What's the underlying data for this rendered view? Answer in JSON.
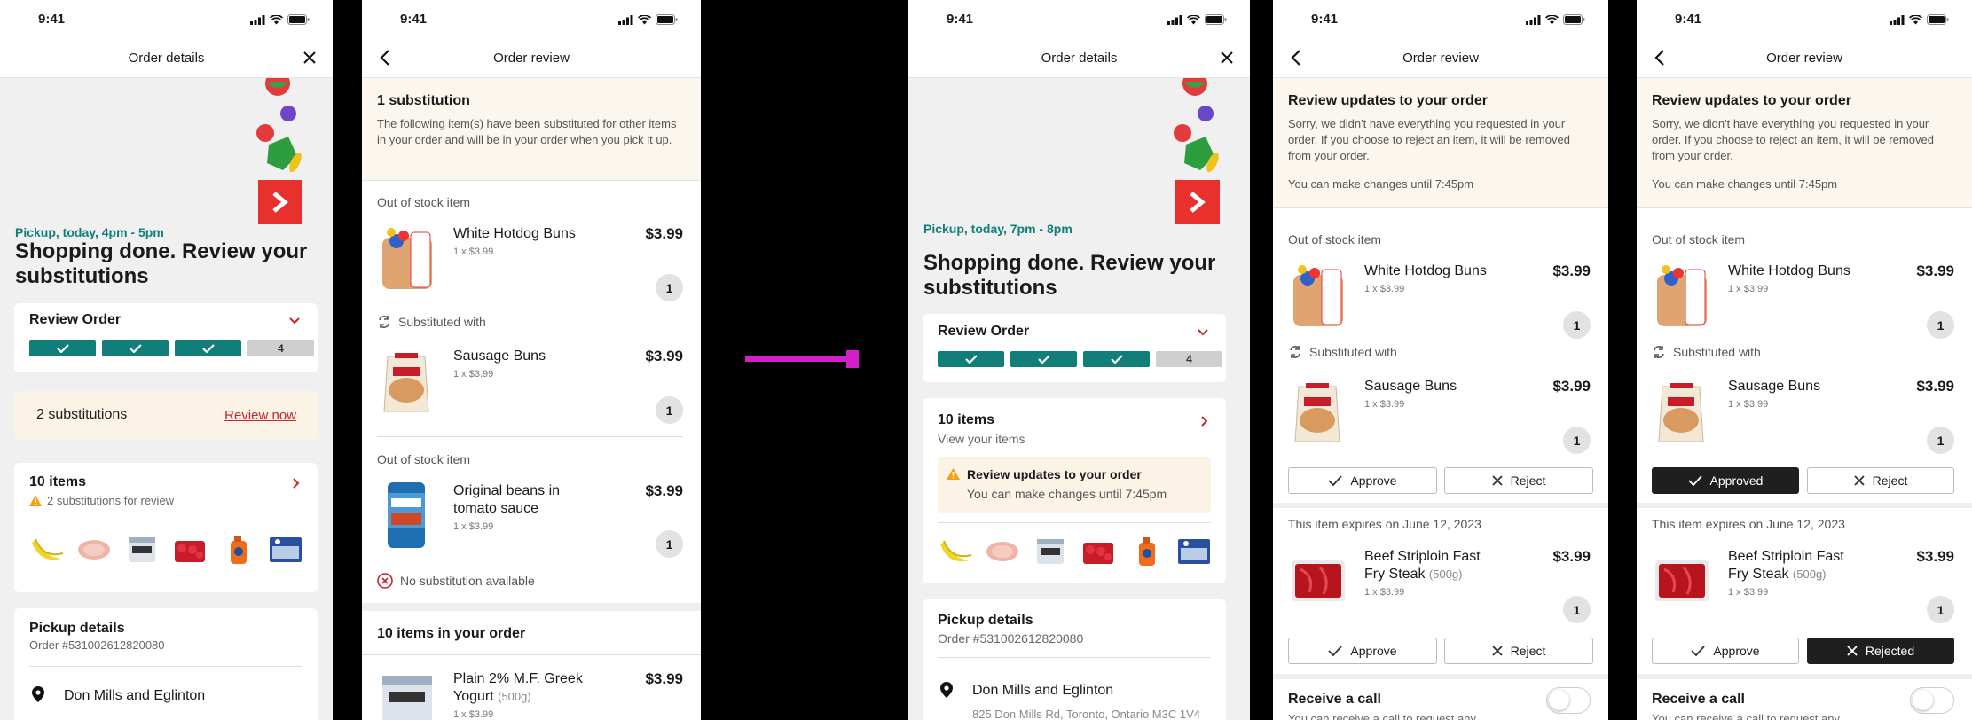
{
  "status": {
    "time": "9:41"
  },
  "screen1": {
    "nav_title": "Order details",
    "pickup_time": "Pickup, today, 4pm - 5pm",
    "headline": "Shopping done. Review your substitutions",
    "review_order_title": "Review Order",
    "progress": {
      "steps_done": 3,
      "steps_total": 4,
      "next_step_label": "4"
    },
    "subs_count": "2 substitutions",
    "review_now": "Review now",
    "items_title": "10 items",
    "items_warning": "2 substitutions for review",
    "pickup_title": "Pickup details",
    "order_no": "Order #531002612820080",
    "store": "Don Mills and Eglinton"
  },
  "screen2": {
    "nav_title": "Order review",
    "banner_title": "1 substitution",
    "banner_text": "The following item(s) have been substituted for other items in your order and will be in your order when you pick it up.",
    "out_of_stock_label": "Out of stock item",
    "item1": {
      "name": "White Hotdog Buns",
      "qty": "1 x $3.99",
      "price": "$3.99",
      "count": "1"
    },
    "substituted_with": "Substituted with",
    "item2": {
      "name": "Sausage Buns",
      "qty": "1 x $3.99",
      "price": "$3.99",
      "count": "1"
    },
    "out_of_stock_label_2": "Out of stock item",
    "item3": {
      "name": "Original beans in tomato sauce",
      "qty": "1 x $3.99",
      "price": "$3.99",
      "count": "1"
    },
    "no_sub": "No substitution available",
    "section_title": "10 items in your order",
    "item4": {
      "name": "Plain 2% M.F. Greek Yogurt",
      "size": "(500g)",
      "qty": "1 x $3.99",
      "price": "$3.99"
    }
  },
  "screen3": {
    "nav_title": "Order details",
    "pickup_time": "Pickup, today, 7pm - 8pm",
    "headline": "Shopping done. Review your substitutions",
    "review_order_title": "Review Order",
    "progress": {
      "steps_done": 3,
      "steps_total": 4,
      "next_step_label": "4"
    },
    "items_title": "10 items",
    "view_items": "View your items",
    "alert_title": "Review updates to your order",
    "alert_text": "You can make changes until 7:45pm",
    "pickup_title": "Pickup details",
    "order_no": "Order #531002612820080",
    "store": "Don Mills and Eglinton",
    "address": "825 Don Mills Rd, Toronto, Ontario M3C 1V4"
  },
  "review_common": {
    "nav_title": "Order review",
    "banner_title": "Review updates to your order",
    "banner_text": "Sorry, we didn't have everything you requested in your order. If you choose to reject an item, it will be removed from your order.",
    "banner_deadline": "You can make changes until 7:45pm",
    "out_of_stock_label": "Out of stock item",
    "item1": {
      "name": "White Hotdog Buns",
      "qty": "1 x $3.99",
      "price": "$3.99",
      "count": "1"
    },
    "substituted_with": "Substituted with",
    "item2": {
      "name": "Sausage Buns",
      "qty": "1 x $3.99",
      "price": "$3.99",
      "count": "1"
    },
    "expires_label": "This item expires on June 12, 2023",
    "item3": {
      "name": "Beef Striploin Fast Fry Steak",
      "size": "(500g)",
      "qty": "1 x $3.99",
      "price": "$3.99",
      "count": "1"
    },
    "receive_call": "Receive a call",
    "receive_call_sub": "You can receive a call to request any"
  },
  "screen4": {
    "approve": "Approve",
    "reject": "Reject",
    "approve2": "Approve",
    "reject2": "Reject"
  },
  "screen5": {
    "approved": "Approved",
    "reject": "Reject",
    "approve2": "Approve",
    "rejected": "Rejected"
  },
  "colors": {
    "teal": "#127e7a",
    "red": "#c2272d",
    "connector": "#d21fc9",
    "cream": "#fbf3e6"
  }
}
